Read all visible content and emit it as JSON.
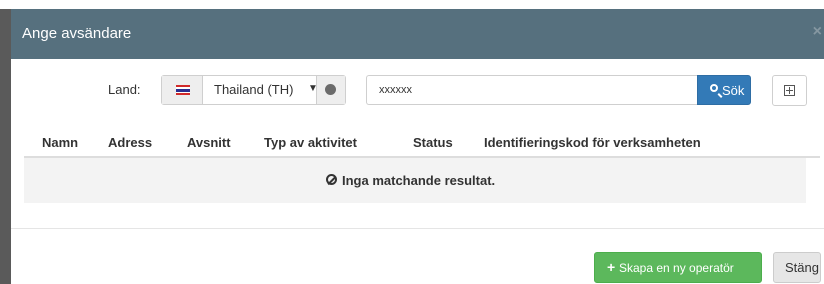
{
  "dialog": {
    "title": "Ange avsändare",
    "close_symbol": "×"
  },
  "search": {
    "country_label": "Land:",
    "country_flag": "thailand-flag",
    "country_value": "Thailand (TH)",
    "country_caret": "▼",
    "query_value": "xxxxxx",
    "search_button_label": "Sök",
    "search_button_icon": "search-icon",
    "expand_icon": "expand-icon"
  },
  "table": {
    "columns": [
      "Namn",
      "Adress",
      "Avsnitt",
      "Typ av aktivitet",
      "Status",
      "Identifieringskod för verksamheten"
    ],
    "empty_icon": "ban-icon",
    "empty_message": "Inga matchande resultat."
  },
  "footer": {
    "create_icon": "plus-icon",
    "create_label": "Skapa en ny operatör",
    "close_label": "Stäng"
  },
  "colors": {
    "header_bg": "#56707e",
    "primary": "#337ab7",
    "success": "#5cb85c"
  }
}
